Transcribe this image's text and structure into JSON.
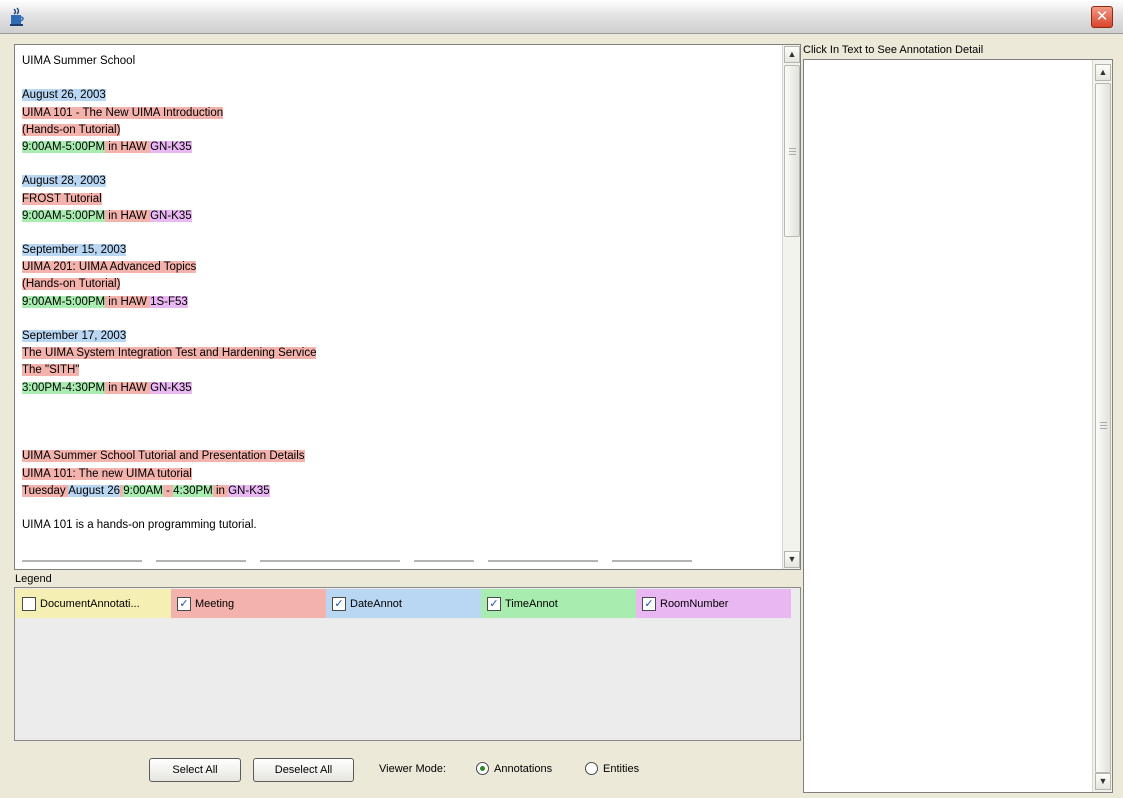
{
  "window": {
    "close_symbol": "✕",
    "icon": "java-cup-icon"
  },
  "document": {
    "lines": [
      [
        {
          "t": "UIMA Summer School",
          "c": ""
        }
      ],
      [],
      [
        {
          "t": "August 26, 2003",
          "c": "date"
        }
      ],
      [
        {
          "t": "UIMA 101 - The New UIMA Introduction",
          "c": "meeting"
        }
      ],
      [
        {
          "t": "(Hands-on Tutorial)",
          "c": "meeting"
        }
      ],
      [
        {
          "t": "9:00AM-5:00PM",
          "c": "time"
        },
        {
          "t": " in HAW ",
          "c": "meeting"
        },
        {
          "t": "GN-K35",
          "c": "room"
        }
      ],
      [],
      [
        {
          "t": "August 28, 2003",
          "c": "date"
        }
      ],
      [
        {
          "t": "FROST Tutorial",
          "c": "meeting"
        }
      ],
      [
        {
          "t": "9:00AM-5:00PM",
          "c": "time"
        },
        {
          "t": " in HAW ",
          "c": "meeting"
        },
        {
          "t": "GN-K35",
          "c": "room"
        }
      ],
      [],
      [
        {
          "t": "September 15, 2003",
          "c": "date"
        }
      ],
      [
        {
          "t": "UIMA 201: UIMA Advanced Topics",
          "c": "meeting"
        }
      ],
      [
        {
          "t": "(Hands-on Tutorial)",
          "c": "meeting"
        }
      ],
      [
        {
          "t": "9:00AM-5:00PM",
          "c": "time"
        },
        {
          "t": " in HAW ",
          "c": "meeting"
        },
        {
          "t": "1S-F53",
          "c": "room"
        }
      ],
      [],
      [
        {
          "t": "September 17, 2003",
          "c": "date"
        }
      ],
      [
        {
          "t": "The UIMA System Integration Test and Hardening Service",
          "c": "meeting"
        }
      ],
      [
        {
          "t": "The \"SITH\"",
          "c": "meeting"
        }
      ],
      [
        {
          "t": "3:00PM-4:30PM",
          "c": "time"
        },
        {
          "t": " in HAW ",
          "c": "meeting"
        },
        {
          "t": "GN-K35",
          "c": "room"
        }
      ],
      [],
      [],
      [],
      [
        {
          "t": "UIMA Summer School Tutorial and Presentation Details",
          "c": "meeting"
        }
      ],
      [
        {
          "t": "UIMA 101: The new UIMA tutorial",
          "c": "meeting"
        }
      ],
      [
        {
          "t": "Tuesday ",
          "c": "meeting"
        },
        {
          "t": "August 26",
          "c": "date"
        },
        {
          "t": " ",
          "c": "meeting"
        },
        {
          "t": "9:00AM",
          "c": "time"
        },
        {
          "t": " - ",
          "c": "meeting"
        },
        {
          "t": "4:30PM",
          "c": "time"
        },
        {
          "t": " in ",
          "c": "meeting"
        },
        {
          "t": "GN-K35",
          "c": "room"
        }
      ],
      [],
      [
        {
          "t": "UIMA 101 is a hands-on programming tutorial.",
          "c": ""
        }
      ]
    ]
  },
  "legend": {
    "label": "Legend",
    "items": [
      {
        "label": "DocumentAnnotati...",
        "checked": false,
        "color": "#f6efb4"
      },
      {
        "label": "Meeting",
        "checked": true,
        "color": "#f3b2ac"
      },
      {
        "label": "DateAnnot",
        "checked": true,
        "color": "#b9d6f2"
      },
      {
        "label": "TimeAnnot",
        "checked": true,
        "color": "#a8ecb0"
      },
      {
        "label": "RoomNumber",
        "checked": true,
        "color": "#e9b8f2"
      }
    ]
  },
  "controls": {
    "select_all": "Select All",
    "deselect_all": "Deselect All",
    "viewer_mode_label": "Viewer Mode:",
    "modes": [
      {
        "label": "Annotations",
        "selected": true
      },
      {
        "label": "Entities",
        "selected": false
      }
    ]
  },
  "detail": {
    "label": "Click In Text to See Annotation Detail"
  }
}
